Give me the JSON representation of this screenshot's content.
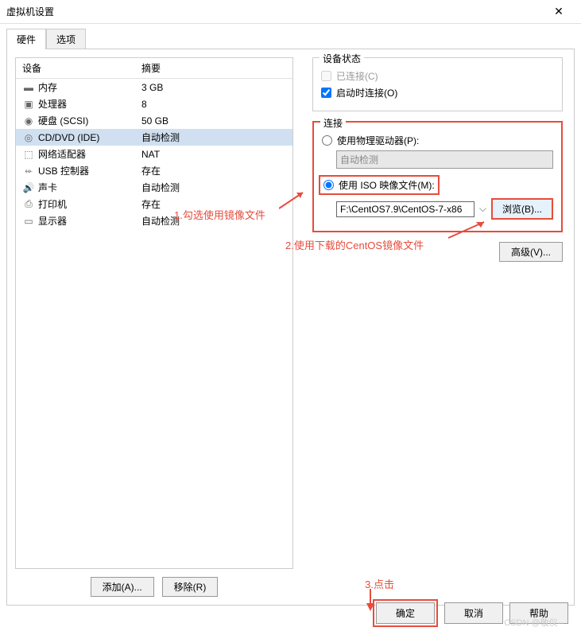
{
  "window": {
    "title": "虚拟机设置",
    "close": "✕"
  },
  "tabs": {
    "hardware": "硬件",
    "options": "选项"
  },
  "table": {
    "header_device": "设备",
    "header_summary": "摘要",
    "rows": [
      {
        "name": "内存",
        "summary": "3 GB",
        "icon": "memory"
      },
      {
        "name": "处理器",
        "summary": "8",
        "icon": "cpu"
      },
      {
        "name": "硬盘 (SCSI)",
        "summary": "50 GB",
        "icon": "disk"
      },
      {
        "name": "CD/DVD (IDE)",
        "summary": "自动检测",
        "icon": "cd",
        "selected": true
      },
      {
        "name": "网络适配器",
        "summary": "NAT",
        "icon": "network"
      },
      {
        "name": "USB 控制器",
        "summary": "存在",
        "icon": "usb"
      },
      {
        "name": "声卡",
        "summary": "自动检测",
        "icon": "sound"
      },
      {
        "name": "打印机",
        "summary": "存在",
        "icon": "printer"
      },
      {
        "name": "显示器",
        "summary": "自动检测",
        "icon": "display"
      }
    ]
  },
  "buttons": {
    "add": "添加(A)...",
    "remove": "移除(R)",
    "browse": "浏览(B)...",
    "advanced": "高级(V)...",
    "ok": "确定",
    "cancel": "取消",
    "help": "帮助"
  },
  "status_group": {
    "title": "设备状态",
    "connected": "已连接(C)",
    "connect_on_start": "启动时连接(O)"
  },
  "connection_group": {
    "title": "连接",
    "physical": "使用物理驱动器(P):",
    "physical_value": "自动检测",
    "iso": "使用 ISO 映像文件(M):",
    "iso_path": "F:\\CentOS7.9\\CentOS-7-x86"
  },
  "annotations": {
    "a1": "1.勾选使用镜像文件",
    "a2": "2.使用下载的CentOS镜像文件",
    "a3": "3.点击"
  },
  "watermark": "CSDN @敬仪--"
}
